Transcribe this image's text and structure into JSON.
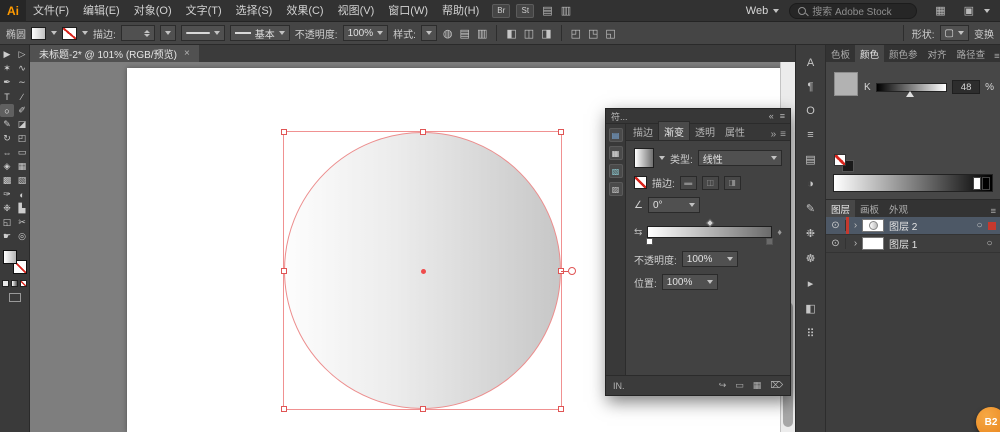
{
  "menubar": {
    "logo": "Ai",
    "items": [
      "文件(F)",
      "编辑(E)",
      "对象(O)",
      "文字(T)",
      "选择(S)",
      "效果(C)",
      "视图(V)",
      "窗口(W)",
      "帮助(H)"
    ],
    "badges": [
      "Br",
      "St"
    ],
    "workspace": "Web",
    "search_placeholder": "搜索 Adobe Stock"
  },
  "controlbar": {
    "object_label": "椭圆",
    "stroke_label": "描边:",
    "brush_value": "基本",
    "opacity_label": "不透明度:",
    "opacity_value": "100%",
    "style_label": "样式:",
    "shape_label": "形状:",
    "transform_label": "变换"
  },
  "doc_tab": {
    "title": "未标题-2* @ 101% (RGB/预览)",
    "close": "×"
  },
  "tools": [
    {
      "name": "selection-tool",
      "glyph": "▶"
    },
    {
      "name": "direct-selection-tool",
      "glyph": "▷"
    },
    {
      "name": "magic-wand-tool",
      "glyph": "✶"
    },
    {
      "name": "lasso-tool",
      "glyph": "∿"
    },
    {
      "name": "pen-tool",
      "glyph": "✒"
    },
    {
      "name": "curvature-tool",
      "glyph": "∼"
    },
    {
      "name": "type-tool",
      "glyph": "T"
    },
    {
      "name": "line-segment-tool",
      "glyph": "∕"
    },
    {
      "name": "ellipse-tool",
      "glyph": "○"
    },
    {
      "name": "paintbrush-tool",
      "glyph": "✐"
    },
    {
      "name": "pencil-tool",
      "glyph": "✎"
    },
    {
      "name": "eraser-tool",
      "glyph": "◪"
    },
    {
      "name": "rotate-tool",
      "glyph": "↻"
    },
    {
      "name": "scale-tool",
      "glyph": "◰"
    },
    {
      "name": "width-tool",
      "glyph": "⇔"
    },
    {
      "name": "free-transform-tool",
      "glyph": "▭"
    },
    {
      "name": "shape-builder-tool",
      "glyph": "◈"
    },
    {
      "name": "perspective-grid-tool",
      "glyph": "▦"
    },
    {
      "name": "mesh-tool",
      "glyph": "▩"
    },
    {
      "name": "gradient-tool",
      "glyph": "▧"
    },
    {
      "name": "eyedropper-tool",
      "glyph": "✑"
    },
    {
      "name": "blend-tool",
      "glyph": "◐"
    },
    {
      "name": "symbol-sprayer-tool",
      "glyph": "❉"
    },
    {
      "name": "column-graph-tool",
      "glyph": "▙"
    },
    {
      "name": "artboard-tool",
      "glyph": "◱"
    },
    {
      "name": "slice-tool",
      "glyph": "✂"
    },
    {
      "name": "hand-tool",
      "glyph": "☛"
    },
    {
      "name": "zoom-tool",
      "glyph": "◎"
    }
  ],
  "gradient_panel": {
    "dock_title": "符...",
    "tabs": [
      "描边",
      "渐变",
      "透明",
      "属性"
    ],
    "type_label": "类型:",
    "type_value": "线性",
    "stroke_label": "描边:",
    "angle_symbol": "∠",
    "angle_value": "0°",
    "opacity_label": "不透明度:",
    "opacity_value": "100%",
    "location_label": "位置:",
    "location_value": "100%",
    "footer_left": "IN.",
    "strip_icons": [
      {
        "name": "swatches-mini-icon",
        "glyph": "▤"
      },
      {
        "name": "brushes-mini-icon",
        "glyph": "▦"
      },
      {
        "name": "symbols-mini-icon",
        "glyph": "▧"
      },
      {
        "name": "graphic-styles-mini-icon",
        "glyph": "▨"
      }
    ],
    "stroke_buttons": [
      "▬",
      "◫",
      "◨"
    ],
    "footer_icons": [
      {
        "name": "flip-icon",
        "glyph": "↪"
      },
      {
        "name": "duplicate-icon",
        "glyph": "▭"
      },
      {
        "name": "grid-icon",
        "glyph": "▦"
      },
      {
        "name": "trash-icon",
        "glyph": "⌦"
      }
    ]
  },
  "dock": {
    "icons": [
      {
        "name": "character-panel-icon",
        "glyph": "A"
      },
      {
        "name": "paragraph-panel-icon",
        "glyph": "¶"
      },
      {
        "name": "opentype-panel-icon",
        "glyph": "O"
      },
      {
        "name": "appearance-panel-icon",
        "glyph": "≡"
      },
      {
        "name": "swatches-panel-icon",
        "glyph": "▤"
      },
      {
        "name": "color-guide-panel-icon",
        "glyph": "◑"
      },
      {
        "name": "brushes-panel-icon",
        "glyph": "✎"
      },
      {
        "name": "symbols-panel-icon",
        "glyph": "❉"
      },
      {
        "name": "gear-icon",
        "glyph": "☸"
      },
      {
        "name": "actions-panel-icon",
        "glyph": "▸"
      },
      {
        "name": "links-panel-icon",
        "glyph": "◧"
      },
      {
        "name": "transform-panel-icon",
        "glyph": "⠿"
      }
    ],
    "panel_tabs": [
      "色板",
      "颜色",
      "颜色参",
      "对齐",
      "路径查"
    ],
    "color_panel": {
      "channel": "K",
      "value": "48",
      "percent": "%"
    },
    "layers_tabs": [
      "图层",
      "画板",
      "外观"
    ],
    "layers": [
      {
        "name": "图层 2"
      },
      {
        "name": "图层 1"
      }
    ]
  },
  "badge": {
    "label": "B2"
  },
  "icons": {
    "eye": "⊙",
    "expand": "›",
    "target": "○",
    "overflow": "»",
    "menu": "≡",
    "collapse": "«",
    "globe": "◍",
    "doc_grid": "▤",
    "doc_cols": "▥",
    "align": [
      "◧",
      "◫",
      "◨"
    ],
    "valign": [
      "◰",
      "◳",
      "◱"
    ],
    "shape": "▢",
    "reverse": "⇆",
    "droplet": "♦",
    "arrange_docs": "▤",
    "grid_view": "▥",
    "workspace_layout": "▦",
    "panels": "▣"
  },
  "colors": {
    "selection_red": "#e96a6a",
    "badge_orange": "#ee8d1f",
    "current_fill_gray": "#b2b2b2",
    "layer_color": "#c5392e"
  }
}
